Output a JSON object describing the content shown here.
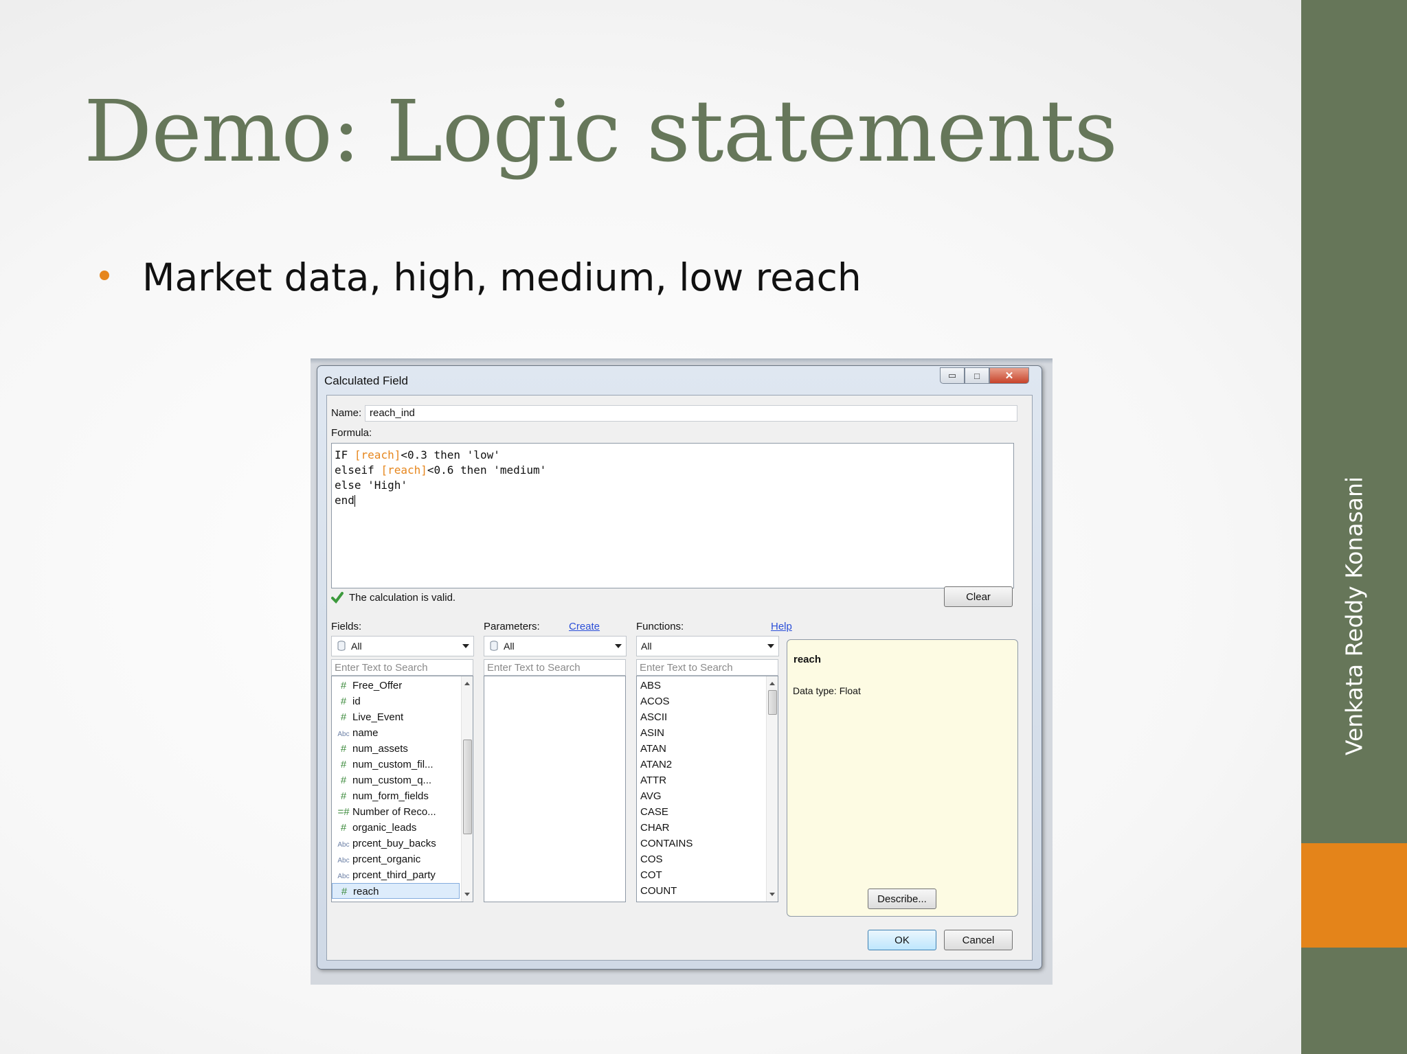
{
  "slide": {
    "title": "Demo: Logic statements",
    "bullet": "Market data, high, medium, low reach",
    "author": "Venkata Reddy Konasani"
  },
  "dialog": {
    "title": "Calculated Field",
    "name_label": "Name:",
    "name_value": "reach_ind",
    "formula_label": "Formula:",
    "formula": [
      {
        "a": "IF ",
        "field": "[reach]",
        "b": "<0.3 then 'low'"
      },
      {
        "a": "elseif ",
        "field": "[reach]",
        "b": "<0.6 then 'medium'"
      },
      {
        "a": "else 'High'",
        "field": "",
        "b": ""
      },
      {
        "a": "end",
        "field": "",
        "b": ""
      }
    ],
    "validation": "The calculation is valid.",
    "clear_label": "Clear",
    "fields_label": "Fields:",
    "fields_filter": "All",
    "fields_search_placeholder": "Enter Text to Search",
    "fields": [
      {
        "icon": "#",
        "name": "Free_Offer"
      },
      {
        "icon": "#",
        "name": "id"
      },
      {
        "icon": "#",
        "name": "Live_Event"
      },
      {
        "icon": "Abc",
        "name": "name"
      },
      {
        "icon": "#",
        "name": "num_assets"
      },
      {
        "icon": "#",
        "name": "num_custom_fil..."
      },
      {
        "icon": "#",
        "name": "num_custom_q..."
      },
      {
        "icon": "#",
        "name": "num_form_fields"
      },
      {
        "icon": "=#",
        "name": "Number of Reco..."
      },
      {
        "icon": "#",
        "name": "organic_leads"
      },
      {
        "icon": "Abc",
        "name": "prcent_buy_backs"
      },
      {
        "icon": "Abc",
        "name": "prcent_organic"
      },
      {
        "icon": "Abc",
        "name": "prcent_third_party"
      },
      {
        "icon": "#",
        "name": "reach"
      }
    ],
    "parameters_label": "Parameters:",
    "parameters_create": "Create",
    "parameters_filter": "All",
    "parameters_search_placeholder": "Enter Text to Search",
    "functions_label": "Functions:",
    "functions_help": "Help",
    "functions_filter": "All",
    "functions_search_placeholder": "Enter Text to Search",
    "functions": [
      "ABS",
      "ACOS",
      "ASCII",
      "ASIN",
      "ATAN",
      "ATAN2",
      "ATTR",
      "AVG",
      "CASE",
      "CHAR",
      "CONTAINS",
      "COS",
      "COT",
      "COUNT"
    ],
    "description": {
      "title": "reach",
      "type": "Data type: Float",
      "describe_label": "Describe..."
    },
    "ok_label": "OK",
    "cancel_label": "Cancel"
  }
}
